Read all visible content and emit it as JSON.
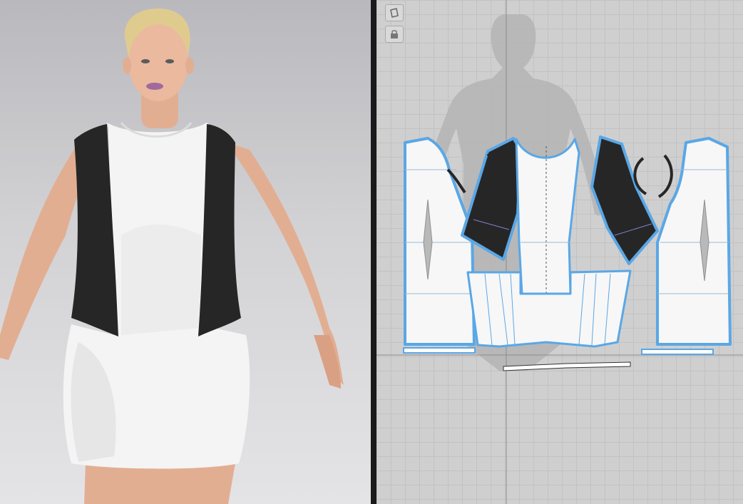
{
  "app": {
    "views": [
      "3d-view",
      "2d-pattern-view"
    ]
  },
  "toolbar_2d": {
    "tools": [
      {
        "icon": "avatar-toggle-icon"
      },
      {
        "icon": "lock-icon"
      }
    ]
  },
  "garment": {
    "body_fabric_color": "#f4f4f4",
    "side_panel_color": "#262626",
    "pattern_outline_color": "#5aa7e6",
    "selected_outline_color": "#4a90d9"
  },
  "avatar": {
    "skin_color": "#e6b59a",
    "hair_color": "#e3cf95"
  }
}
